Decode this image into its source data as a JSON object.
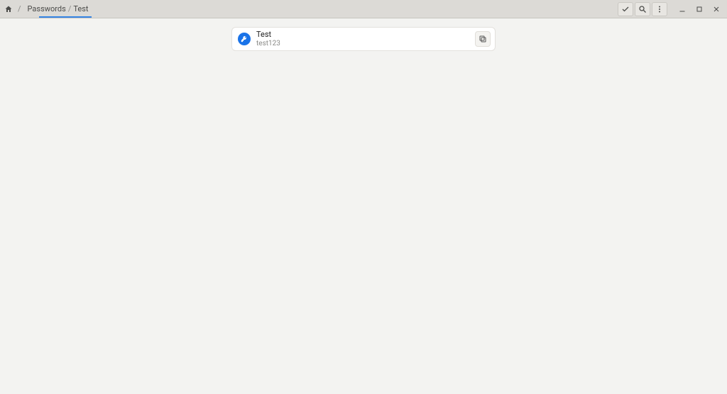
{
  "breadcrumb": {
    "root_label": "Passwords",
    "current_label": "Test"
  },
  "entry": {
    "title": "Test",
    "username": "test123"
  }
}
